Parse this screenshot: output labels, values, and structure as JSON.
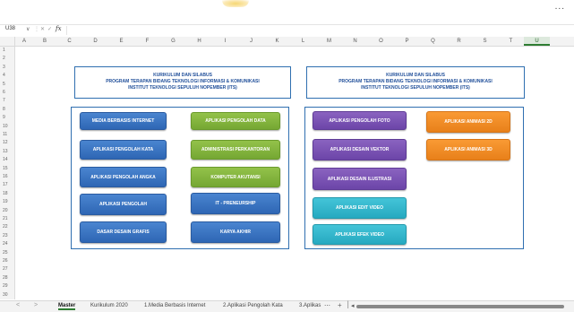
{
  "toolbar": {
    "more_label": "..."
  },
  "formula_bar": {
    "name_box": "U38",
    "chevron": "∨",
    "separator": "⋮",
    "cancel": "✕",
    "confirm": "✓",
    "fx": "fx",
    "value": ""
  },
  "columns": [
    "A",
    "B",
    "C",
    "D",
    "E",
    "F",
    "G",
    "H",
    "I",
    "J",
    "K",
    "L",
    "M",
    "N",
    "O",
    "P",
    "Q",
    "R",
    "S",
    "T",
    "U"
  ],
  "selected_column": "U",
  "rows": [
    "1",
    "2",
    "3",
    "4",
    "5",
    "6",
    "7",
    "8",
    "9",
    "10",
    "11",
    "12",
    "13",
    "14",
    "15",
    "16",
    "17",
    "18",
    "19",
    "20",
    "21",
    "22",
    "23",
    "24",
    "25",
    "26",
    "27",
    "28",
    "29",
    "30"
  ],
  "left_panel": {
    "title": [
      "KURIKULUM DAN SILABUS",
      "PROGRAM TERAPAN BIDANG TEKNOLOGI INFORMASI & KOMUNIKASI",
      "INSTITUT TEKNOLOGI SEPULUH NOPEMBER (ITS)"
    ],
    "buttons": [
      {
        "label": "MEDIA BERBASIS INTERNET",
        "color": "#3c79c6"
      },
      {
        "label": "APLIKASI PENGOLAH DATA",
        "color": "#86b83f"
      },
      {
        "label": "APLIKASI PENGOLAH KATA",
        "color": "#3c79c6"
      },
      {
        "label": "ADMINISTRASI PERKANTORAN",
        "color": "#86b83f"
      },
      {
        "label": "APLIKASI PENGOLAH ANGKA",
        "color": "#3c79c6"
      },
      {
        "label": "KOMPUTER AKUTANSI",
        "color": "#86b83f"
      },
      {
        "label": "APLIKASI PENGOLAH",
        "color": "#3c79c6"
      },
      {
        "label": "IT - PRENEURSHIP",
        "color": "#3c79c6"
      },
      {
        "label": "DASAR DESAIN GRAFIS",
        "color": "#3c79c6"
      },
      {
        "label": "KARYA AKHIR",
        "color": "#3c79c6"
      }
    ]
  },
  "right_panel": {
    "title": [
      "KURIKULUM DAN SILABUS",
      "PROGRAM TERAPAN BIDANG TEKNOLOGI INFORMASI & KOMUNIKASI",
      "INSTITUT TEKNOLOGI SEPULUH NOPEMBER (ITS)"
    ],
    "buttons": [
      {
        "label": "APLIKASI PENGOLAH FOTO",
        "color": "#7a54b4"
      },
      {
        "label": "APLIKASI ANIMASI 2D",
        "color": "#f08c28"
      },
      {
        "label": "APLIKASI DESAIN VEKTOR",
        "color": "#7a54b4"
      },
      {
        "label": "APLIKASI ANIMASI 3D",
        "color": "#f08c28"
      },
      {
        "label": "APLIKASI DESAIN ILUSTRASI",
        "color": "#7a54b4"
      },
      {
        "label": "APLIKASI  EDIT VIDEO",
        "color": "#35b6cc"
      },
      {
        "label": "APLIKASI EFEK  VIDEO",
        "color": "#35b6cc"
      }
    ]
  },
  "sheet_tabs": {
    "prev": "<",
    "next": ">",
    "tabs": [
      "Master",
      "Kurikulum 2020",
      "1.Media Berbasis Internet",
      "2.Aplikasi Pengolah Kata",
      "3.Aplikas"
    ],
    "active": "Master",
    "more": "⋯",
    "add": "+",
    "divider": "│",
    "scroll_left": "◂"
  },
  "colors": {
    "accent": "#2e7d32",
    "panel_border": "#2f6fb0",
    "title_text": "#1f4e99"
  }
}
